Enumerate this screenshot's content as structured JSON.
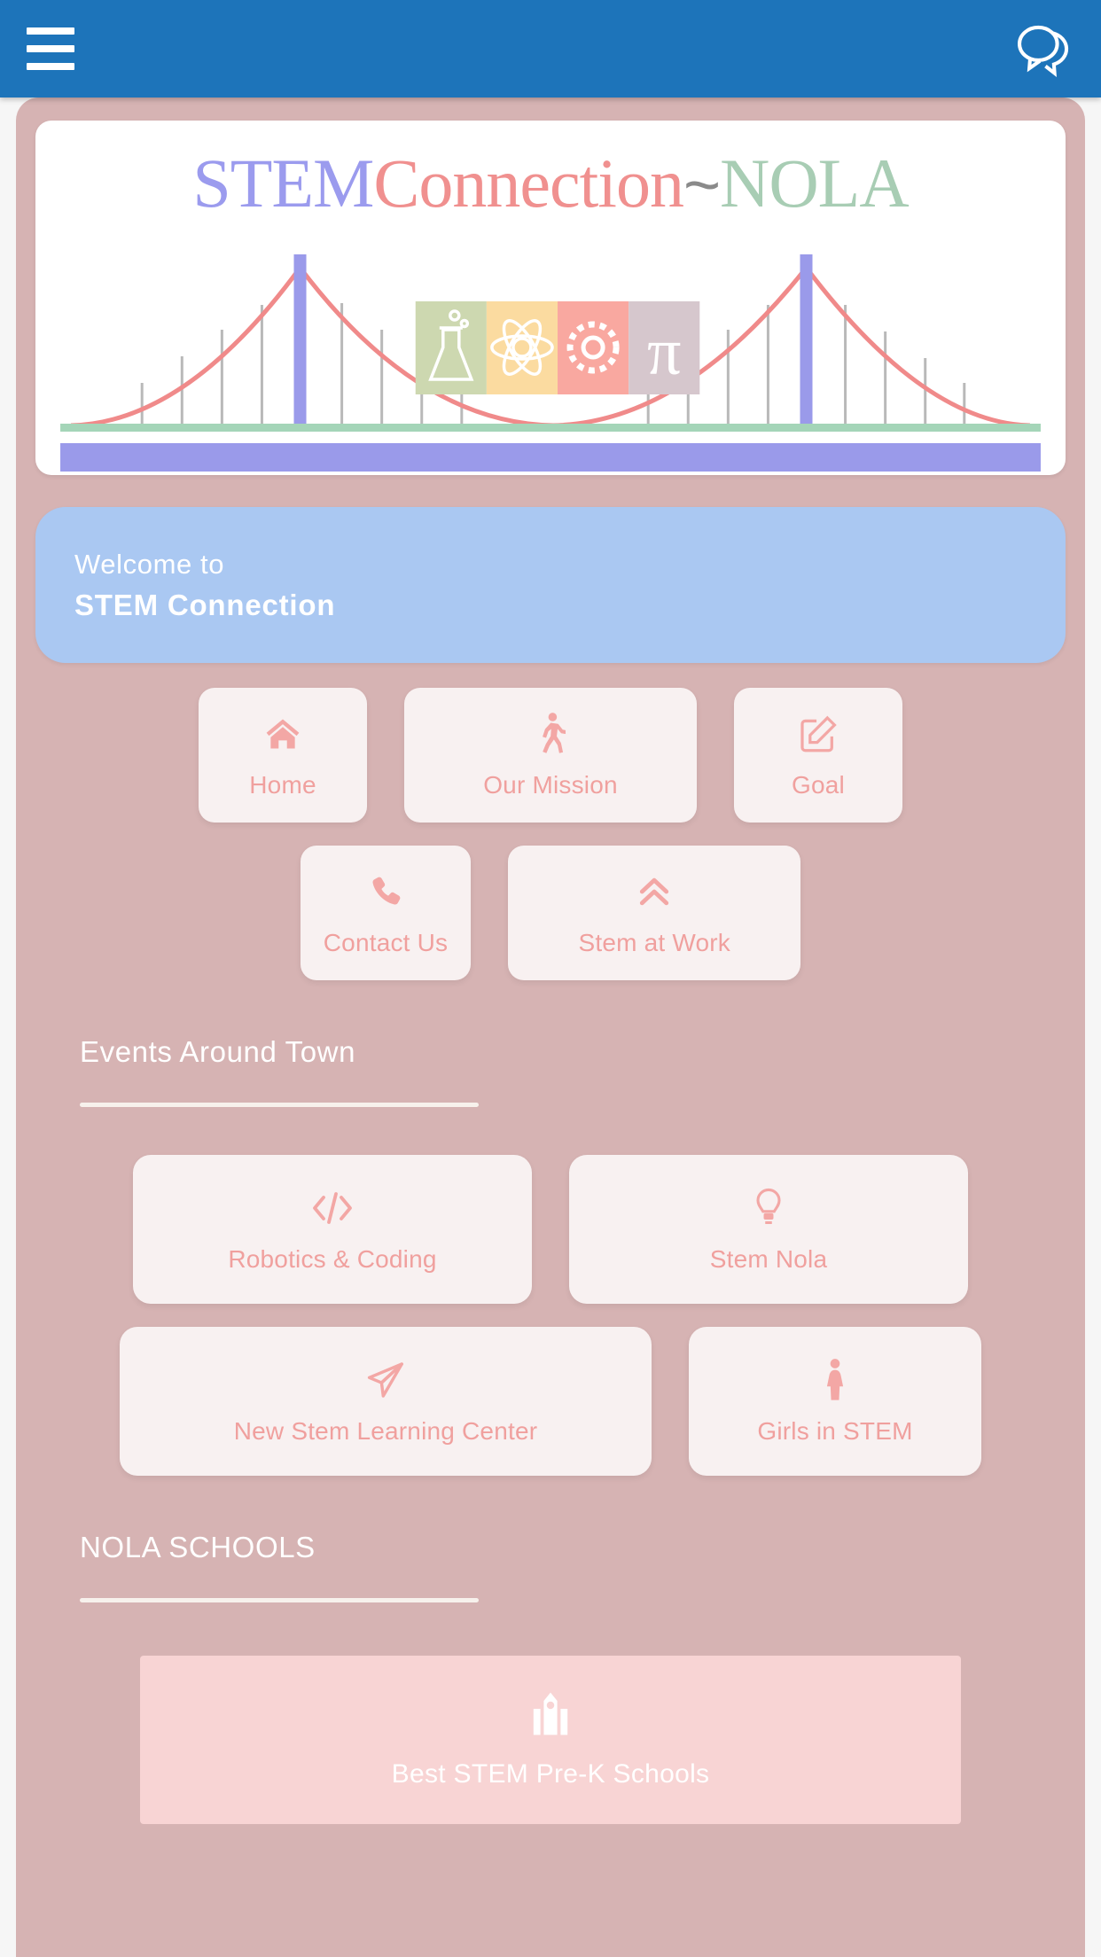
{
  "appbar": {
    "menu_icon": "hamburger-menu-icon",
    "chat_icon": "chat-bubbles-icon",
    "background_color": "#1d74ba"
  },
  "logo": {
    "part1": "STEM",
    "part2": "Connection",
    "part3": "~",
    "part4": "NOLA",
    "colors": {
      "part1": "#9b9bee",
      "part2": "#f0908f",
      "part3": "#8a8a8a",
      "part4": "#a8cdb4"
    },
    "tiles": [
      {
        "name": "science-flask-tile",
        "color": "#cdd8b0"
      },
      {
        "name": "technology-atom-tile",
        "color": "#fbdba0"
      },
      {
        "name": "engineering-gear-tile",
        "color": "#f9a8a0"
      },
      {
        "name": "math-pi-tile",
        "color": "#d6c7cd"
      }
    ]
  },
  "welcome": {
    "line1": "Welcome to",
    "line2": "STEM Connection",
    "background_color": "#aac8f2"
  },
  "nav_tiles_row1": [
    {
      "label": "Home",
      "icon": "home-icon"
    },
    {
      "label": "Our Mission",
      "icon": "walking-person-icon"
    },
    {
      "label": "Goal",
      "icon": "edit-pencil-square-icon"
    }
  ],
  "nav_tiles_row2": [
    {
      "label": "Contact Us",
      "icon": "phone-icon"
    },
    {
      "label": "Stem at Work",
      "icon": "double-chevron-up-icon"
    }
  ],
  "events_section": {
    "title": "Events Around Town",
    "tiles_row1": [
      {
        "label": "Robotics & Coding",
        "icon": "code-brackets-icon"
      },
      {
        "label": "Stem Nola",
        "icon": "lightbulb-icon"
      }
    ],
    "tiles_row2": [
      {
        "label": "New Stem Learning Center",
        "icon": "paper-plane-icon"
      },
      {
        "label": "Girls in STEM",
        "icon": "female-person-icon"
      }
    ]
  },
  "schools_section": {
    "title": "NOLA SCHOOLS",
    "cards": [
      {
        "label": "Best STEM Pre-K Schools",
        "icon": "school-building-icon",
        "background_color": "#f8d4d4"
      }
    ]
  },
  "theme": {
    "page_background": "#f6f6f6",
    "card_background": "#d6b3b3",
    "tile_background": "rgba(255,255,255,0.82)",
    "accent_text": "#f0a09e"
  }
}
